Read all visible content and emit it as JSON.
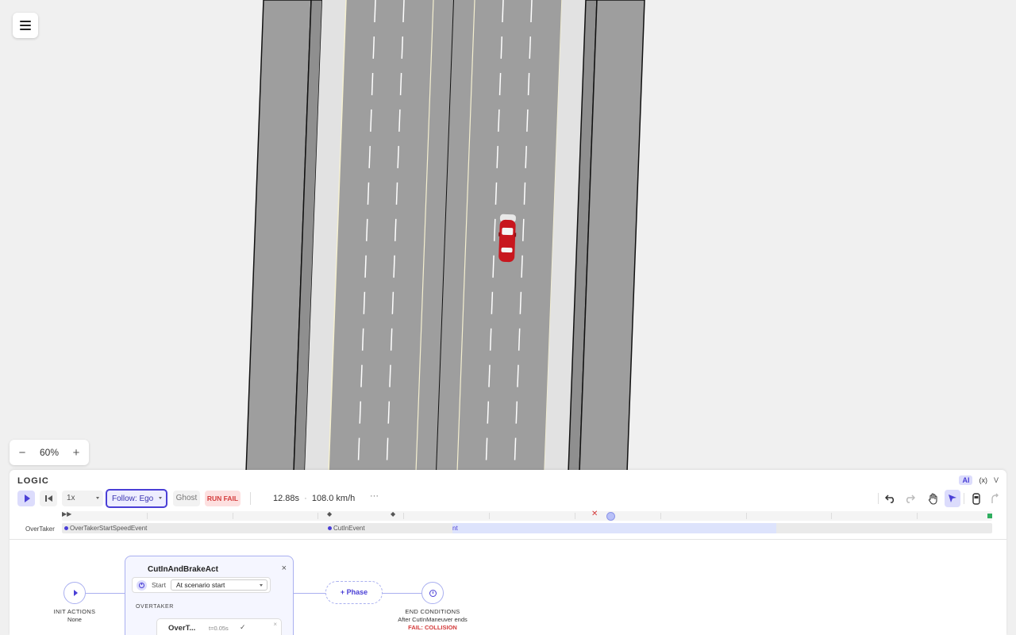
{
  "menu": {
    "icon": "hamburger-menu-icon"
  },
  "zoom": {
    "minus": "−",
    "value": "60%",
    "plus": "+"
  },
  "logic_panel": {
    "title": "LOGIC",
    "tags": {
      "ai": "AI",
      "variables": "(x)",
      "collapse": "V"
    },
    "toolbar": {
      "play_icon": "play-icon",
      "rewind_icon": "rewind-icon",
      "speed": "1x",
      "follow": "Follow: Ego",
      "ghost": "Ghost",
      "run_fail": "RUN FAIL",
      "time": "12.88s",
      "separator": "·",
      "speed_kmh": "108.0 km/h",
      "more": "···",
      "right_icons": [
        "undo-icon",
        "redo-icon",
        "hand-icon",
        "pointer-icon",
        "car-icon",
        "route-icon"
      ]
    },
    "timeline": {
      "markers": [
        "skip-to-start",
        "diamond",
        "diamond",
        "fail-cross",
        "playhead",
        "end"
      ],
      "playhead_fraction": 0.59
    },
    "lane": {
      "label": "OverTaker",
      "events": [
        "OverTakerStartSpeedEvent",
        "CutInEvent",
        "nt"
      ]
    },
    "flow": {
      "init_actions_label": "INIT ACTIONS",
      "init_actions_value": "None",
      "act": {
        "title": "CutInAndBrakeAct",
        "close": "×",
        "start_label": "Start",
        "start_value": "At scenario start",
        "entity_label": "OVERTAKER",
        "maneuver": {
          "name": "OverT...",
          "time": "t=0.05s",
          "check": "✓",
          "close": "×"
        }
      },
      "phase_button": "+ Phase",
      "end_conditions_label": "END CONDITIONS",
      "end_conditions_detail": "After CutInManeuver ends",
      "end_conditions_fail": "FAIL: COLLISION"
    }
  },
  "colors": {
    "accent": "#4a3fd6",
    "accent_soft": "#dcdcfc",
    "fail": "#d43c3c",
    "asphalt": "#9e9e9e",
    "shoulder": "#e2e2e2",
    "car": "#c8161e"
  }
}
